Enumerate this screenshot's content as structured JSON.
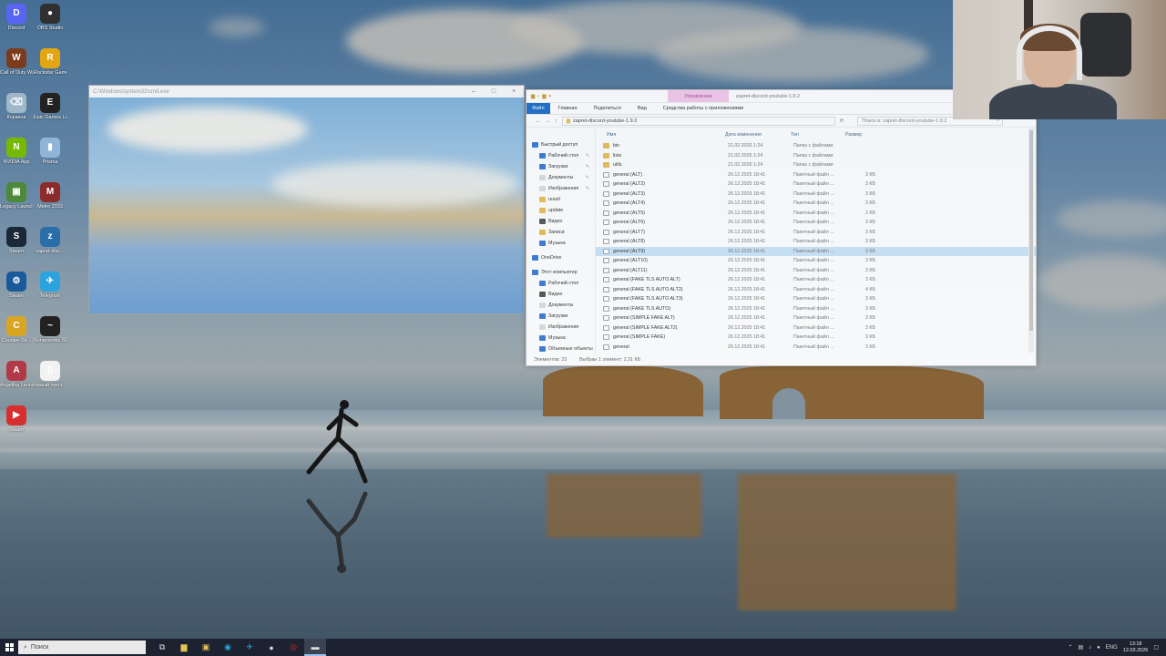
{
  "desktop": {
    "icons": [
      {
        "label": "Discord",
        "glyph": "D",
        "color": "#5865f2"
      },
      {
        "label": "OBS Studio",
        "glyph": "●",
        "color": "#303030"
      },
      {
        "label": "Call of Duty Warzone",
        "glyph": "W",
        "color": "#7b3b1d"
      },
      {
        "label": "Rockstar Games",
        "glyph": "R",
        "color": "#e1a612"
      },
      {
        "label": "Корзина",
        "glyph": "⌫",
        "color": "#9fb8c9"
      },
      {
        "label": "Epic Games Launcher",
        "glyph": "E",
        "color": "#222"
      },
      {
        "label": "NVIDIA App",
        "glyph": "N",
        "color": "#76b900"
      },
      {
        "label": "Prisma",
        "glyph": "▮",
        "color": "#8fb4d8"
      },
      {
        "label": "Legacy Launcher",
        "glyph": "▣",
        "color": "#4c8a3a"
      },
      {
        "label": "Metro 2033",
        "glyph": "M",
        "color": "#8c2b2b"
      },
      {
        "label": "Steam",
        "glyph": "S",
        "color": "#1b2838"
      },
      {
        "label": "zapret-disc...",
        "glyph": "z",
        "color": "#2a6ea8"
      },
      {
        "label": "Steam",
        "glyph": "⚙",
        "color": "#1b5a9a"
      },
      {
        "label": "Telegram",
        "glyph": "✈",
        "color": "#2aa3df"
      },
      {
        "label": "Counter-Str...",
        "glyph": "C",
        "color": "#d9a524"
      },
      {
        "label": "Sonarworks SR",
        "glyph": "~",
        "color": "#222"
      },
      {
        "label": "Angelika Launcher",
        "glyph": "A",
        "color": "#b23a48"
      },
      {
        "label": "Новый текст...",
        "glyph": "▯",
        "color": "#f2f2f2"
      },
      {
        "label": "Steam",
        "glyph": "▶",
        "color": "#d62f2f"
      }
    ]
  },
  "cmd_window": {
    "title": "C:\\Windows\\system32\\cmd.exe"
  },
  "explorer": {
    "manage_tab": "Управление",
    "title_path": "zapret-discord-youtube-1.9.2",
    "ribbon_tabs": [
      "Файл",
      "Главная",
      "Поделиться",
      "Вид",
      "Средства работы с приложениями"
    ],
    "address": "zapret-discord-youtube-1.9.2",
    "search_placeholder": "Поиск в: zapret-discord-youtube-1.9.2",
    "nav": [
      {
        "label": "Быстрый доступ",
        "top": true,
        "color": "#3a7bd5"
      },
      {
        "label": "Рабочий стол",
        "color": "#3a7bd5",
        "pin": true
      },
      {
        "label": "Загрузки",
        "color": "#3a7bd5",
        "pin": true
      },
      {
        "label": "Документы",
        "color": "#ddd",
        "pin": true
      },
      {
        "label": "Изображения",
        "color": "#ddd",
        "pin": true
      },
      {
        "label": "result",
        "color": "#e8c055"
      },
      {
        "label": "update",
        "color": "#e8c055"
      },
      {
        "label": "Видео",
        "color": "#555"
      },
      {
        "label": "Записи",
        "color": "#e8c055"
      },
      {
        "label": "Музыка",
        "color": "#3a7bd5"
      },
      {
        "label": "OneDrive",
        "top": true,
        "color": "#3a7bd5"
      },
      {
        "label": "Этот компьютер",
        "top": true,
        "color": "#3a7bd5"
      },
      {
        "label": "Рабочий стол",
        "color": "#3a7bd5"
      },
      {
        "label": "Видео",
        "color": "#555"
      },
      {
        "label": "Документы",
        "color": "#ddd"
      },
      {
        "label": "Загрузки",
        "color": "#3a7bd5"
      },
      {
        "label": "Изображения",
        "color": "#ddd"
      },
      {
        "label": "Музыка",
        "color": "#3a7bd5"
      },
      {
        "label": "Объемные объекты",
        "color": "#3a7bd5"
      }
    ],
    "columns": {
      "name": "Имя",
      "date": "Дата изменения",
      "type": "Тип",
      "size": "Размер"
    },
    "files": [
      {
        "name": "bin",
        "date": "21.02.2026 1:24",
        "type": "Папка с файлами",
        "size": "",
        "kind": "folder"
      },
      {
        "name": "lists",
        "date": "21.02.2026 1:24",
        "type": "Папка с файлами",
        "size": "",
        "kind": "folder"
      },
      {
        "name": "utils",
        "date": "21.02.2026 1:24",
        "type": "Папка с файлами",
        "size": "",
        "kind": "folder"
      },
      {
        "name": "general (ALT)",
        "date": "26.12.2025 18:41",
        "type": "Пакетный файл ...",
        "size": "3 КБ",
        "kind": "bat"
      },
      {
        "name": "general (ALT2)",
        "date": "26.12.2025 18:41",
        "type": "Пакетный файл ...",
        "size": "3 КБ",
        "kind": "bat"
      },
      {
        "name": "general (ALT3)",
        "date": "26.12.2025 18:41",
        "type": "Пакетный файл ...",
        "size": "3 КБ",
        "kind": "bat"
      },
      {
        "name": "general (ALT4)",
        "date": "26.12.2025 18:41",
        "type": "Пакетный файл ...",
        "size": "3 КБ",
        "kind": "bat"
      },
      {
        "name": "general (ALT5)",
        "date": "26.12.2025 18:41",
        "type": "Пакетный файл ...",
        "size": "2 КБ",
        "kind": "bat"
      },
      {
        "name": "general (ALT6)",
        "date": "26.12.2025 18:41",
        "type": "Пакетный файл ...",
        "size": "3 КБ",
        "kind": "bat"
      },
      {
        "name": "general (ALT7)",
        "date": "26.12.2025 18:41",
        "type": "Пакетный файл ...",
        "size": "3 КБ",
        "kind": "bat"
      },
      {
        "name": "general (ALT8)",
        "date": "26.12.2025 18:41",
        "type": "Пакетный файл ...",
        "size": "3 КБ",
        "kind": "bat"
      },
      {
        "name": "general (ALT9)",
        "date": "26.12.2025 18:41",
        "type": "Пакетный файл ...",
        "size": "3 КБ",
        "kind": "bat",
        "selected": true
      },
      {
        "name": "general (ALT10)",
        "date": "26.12.2025 18:41",
        "type": "Пакетный файл ...",
        "size": "3 КБ",
        "kind": "bat"
      },
      {
        "name": "general (ALT11)",
        "date": "26.12.2025 18:41",
        "type": "Пакетный файл ...",
        "size": "3 КБ",
        "kind": "bat"
      },
      {
        "name": "general (FAKE TLS AUTO ALT)",
        "date": "26.12.2025 18:41",
        "type": "Пакетный файл ...",
        "size": "3 КБ",
        "kind": "bat"
      },
      {
        "name": "general (FAKE TLS AUTO ALT2)",
        "date": "26.12.2025 18:41",
        "type": "Пакетный файл ...",
        "size": "4 КБ",
        "kind": "bat"
      },
      {
        "name": "general (FAKE TLS AUTO ALT3)",
        "date": "26.12.2025 18:41",
        "type": "Пакетный файл ...",
        "size": "3 КБ",
        "kind": "bat"
      },
      {
        "name": "general (FAKE TLS AUTO)",
        "date": "26.12.2025 18:41",
        "type": "Пакетный файл ...",
        "size": "3 КБ",
        "kind": "bat"
      },
      {
        "name": "general (SIMPLE FAKE ALT)",
        "date": "26.12.2025 18:41",
        "type": "Пакетный файл ...",
        "size": "3 КБ",
        "kind": "bat"
      },
      {
        "name": "general (SIMPLE FAKE ALT2)",
        "date": "26.12.2025 18:41",
        "type": "Пакетный файл ...",
        "size": "3 КБ",
        "kind": "bat"
      },
      {
        "name": "general (SIMPLE FAKE)",
        "date": "26.12.2025 18:41",
        "type": "Пакетный файл ...",
        "size": "3 КБ",
        "kind": "bat"
      },
      {
        "name": "general",
        "date": "26.12.2025 18:41",
        "type": "Пакетный файл ...",
        "size": "3 КБ",
        "kind": "bat"
      }
    ],
    "status_count": "Элементов: 23",
    "status_selected": "Выбран 1 элемент: 2,31 КБ"
  },
  "taskbar": {
    "search_placeholder": "Поиск",
    "apps": [
      {
        "name": "task-view-icon",
        "glyph": "⧉"
      },
      {
        "name": "file-explorer-icon",
        "glyph": "▆",
        "color": "#e8c055"
      },
      {
        "name": "store-icon",
        "glyph": "▣",
        "color": "#e8c055"
      },
      {
        "name": "browser-icon",
        "glyph": "◉",
        "color": "#2aa3df"
      },
      {
        "name": "telegram-icon",
        "glyph": "✈",
        "color": "#2aa3df"
      },
      {
        "name": "steam-icon",
        "glyph": "●",
        "color": "#c6d4df"
      },
      {
        "name": "opera-icon",
        "glyph": "◎",
        "color": "#e02a2a"
      },
      {
        "name": "cmd-icon",
        "glyph": "▬",
        "color": "#ddd",
        "active": true
      }
    ],
    "lang": "ENG",
    "time": "13:18",
    "date": "12.03.2026"
  }
}
